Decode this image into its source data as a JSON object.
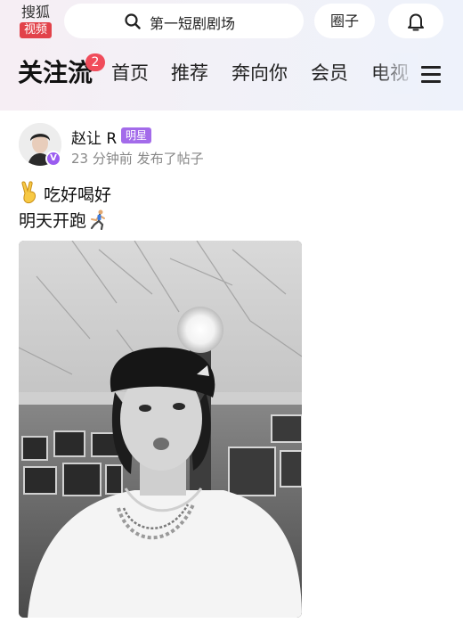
{
  "header": {
    "logo_line1": "搜狐",
    "logo_line2": "视频",
    "search_placeholder": "第一短剧剧场",
    "circle_label": "圈子"
  },
  "tabs": [
    {
      "label": "关注流",
      "badge": "2",
      "active": true
    },
    {
      "label": "首页"
    },
    {
      "label": "推荐"
    },
    {
      "label": "奔向你"
    },
    {
      "label": "会员"
    },
    {
      "label": "电视"
    }
  ],
  "post": {
    "username": "赵让 R",
    "user_badge": "明星",
    "meta": "23 分钟前 发布了帖子",
    "verified_mark": "V",
    "line1": "吃好喝好",
    "line2": "明天开跑"
  },
  "icons": {
    "search": "search-icon",
    "bell": "bell-icon",
    "menu": "menu-icon",
    "victory": "victory-hand-emoji",
    "runner": "runner-emoji"
  },
  "colors": {
    "logo_red": "#e2424a",
    "badge_red": "#f04c5b",
    "purple": "#a36bea"
  }
}
